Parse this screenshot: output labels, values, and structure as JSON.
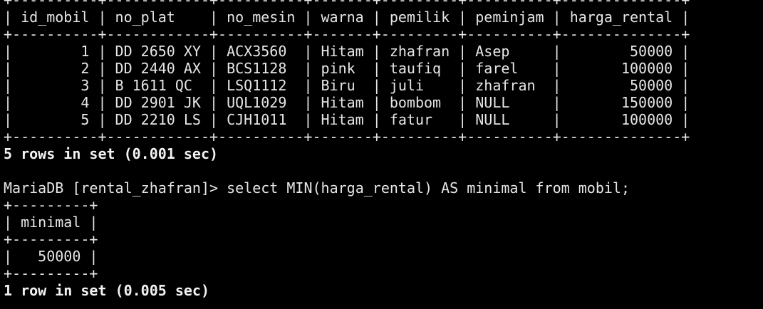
{
  "terminal": {
    "prompt": "MariaDB [rental_zhafran]> ",
    "first_table": {
      "columns": [
        "id_mobil",
        "no_plat",
        "no_mesin",
        "warna",
        "pemilik",
        "peminjam",
        "harga_rental"
      ],
      "align": [
        "right",
        "left",
        "left",
        "left",
        "left",
        "left",
        "right"
      ],
      "widths": [
        10,
        12,
        10,
        7,
        9,
        10,
        14
      ],
      "rows": [
        [
          "1",
          "DD 2650 XY",
          "ACX3560",
          "Hitam",
          "zhafran",
          "Asep",
          "50000"
        ],
        [
          "2",
          "DD 2440 AX",
          "BCS1128",
          "pink",
          "taufiq",
          "farel",
          "100000"
        ],
        [
          "3",
          "B 1611 QC",
          "LSQ1112",
          "Biru",
          "juli",
          "zhafran",
          "50000"
        ],
        [
          "4",
          "DD 2901 JK",
          "UQL1029",
          "Hitam",
          "bombom",
          "NULL",
          "150000"
        ],
        [
          "5",
          "DD 2210 LS",
          "CJH1011",
          "Hitam",
          "fatur",
          "NULL",
          "100000"
        ]
      ],
      "summary": "5 rows in set (0.001 sec)"
    },
    "query": "select MIN(harga_rental) AS minimal from mobil;",
    "second_table": {
      "columns": [
        "minimal"
      ],
      "align": [
        "right"
      ],
      "widths": [
        9
      ],
      "rows": [
        [
          "50000"
        ]
      ],
      "summary": "1 row in set (0.005 sec)"
    }
  }
}
